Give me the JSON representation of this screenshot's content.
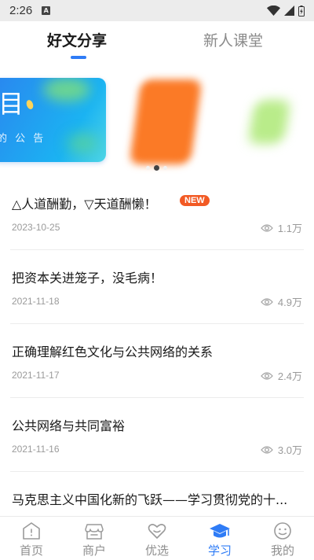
{
  "status_bar": {
    "time": "2:26",
    "notification_letter": "A"
  },
  "top_tabs": [
    {
      "label": "好文分享",
      "active": true
    },
    {
      "label": "新人课堂",
      "active": false
    }
  ],
  "banner": {
    "big_text": "目",
    "subtext": "的 公 告",
    "page_count": 3,
    "current_page": 2
  },
  "articles": [
    {
      "title": "△人道酬勤，▽天道酬懒！",
      "badge": "NEW",
      "date": "2023-10-25",
      "views": "1.1万"
    },
    {
      "title": "把资本关进笼子，没毛病！",
      "badge": "",
      "date": "2021-11-18",
      "views": "4.9万"
    },
    {
      "title": "正确理解红色文化与公共网络的关系",
      "badge": "",
      "date": "2021-11-17",
      "views": "2.4万"
    },
    {
      "title": "公共网络与共同富裕",
      "badge": "",
      "date": "2021-11-16",
      "views": "3.0万"
    },
    {
      "title": "马克思主义中国化新的飞跃——学习贯彻党的十...",
      "badge": "",
      "date": "",
      "views": ""
    }
  ],
  "bottom_nav": [
    {
      "label": "首页",
      "icon": "home-icon",
      "active": false
    },
    {
      "label": "商户",
      "icon": "shop-icon",
      "active": false
    },
    {
      "label": "优选",
      "icon": "heart-icon",
      "active": false
    },
    {
      "label": "学习",
      "icon": "graduation-cap-icon",
      "active": true
    },
    {
      "label": "我的",
      "icon": "profile-icon",
      "active": false
    }
  ],
  "colors": {
    "accent": "#2f7cf6",
    "badge": "#f25a24",
    "text_primary": "#1a1a1a",
    "text_secondary": "#9a9a9a"
  }
}
